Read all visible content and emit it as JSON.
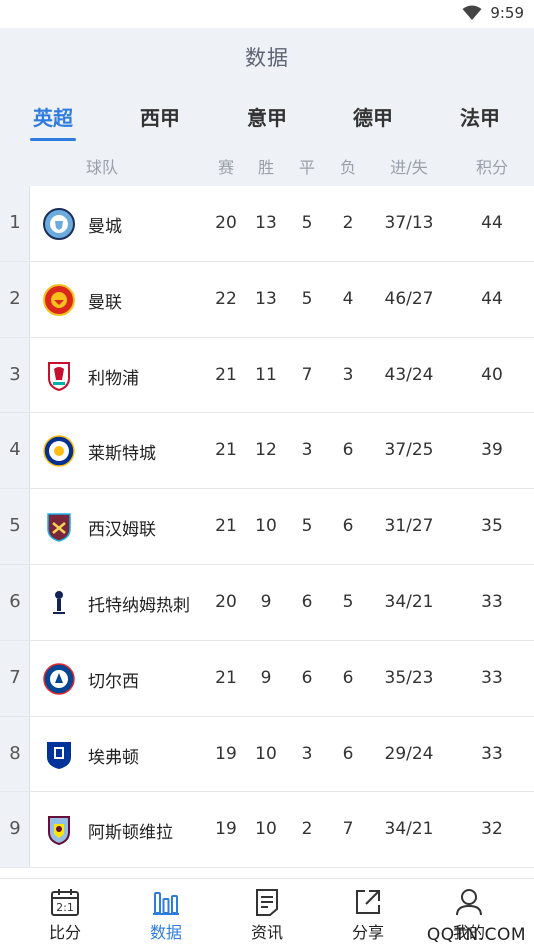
{
  "status_bar": {
    "time": "9:59"
  },
  "header": {
    "title": "数据"
  },
  "tabs": [
    {
      "label": "英超",
      "active": true
    },
    {
      "label": "西甲",
      "active": false
    },
    {
      "label": "意甲",
      "active": false
    },
    {
      "label": "德甲",
      "active": false
    },
    {
      "label": "法甲",
      "active": false
    }
  ],
  "columns": {
    "team": "球队",
    "played": "赛",
    "won": "胜",
    "drawn": "平",
    "lost": "负",
    "goals": "进/失",
    "points": "积分"
  },
  "rows": [
    {
      "rank": "1",
      "team": "曼城",
      "played": "20",
      "won": "13",
      "drawn": "5",
      "lost": "2",
      "goals": "37/13",
      "points": "44"
    },
    {
      "rank": "2",
      "team": "曼联",
      "played": "22",
      "won": "13",
      "drawn": "5",
      "lost": "4",
      "goals": "46/27",
      "points": "44"
    },
    {
      "rank": "3",
      "team": "利物浦",
      "played": "21",
      "won": "11",
      "drawn": "7",
      "lost": "3",
      "goals": "43/24",
      "points": "40"
    },
    {
      "rank": "4",
      "team": "莱斯特城",
      "played": "21",
      "won": "12",
      "drawn": "3",
      "lost": "6",
      "goals": "37/25",
      "points": "39"
    },
    {
      "rank": "5",
      "team": "西汉姆联",
      "played": "21",
      "won": "10",
      "drawn": "5",
      "lost": "6",
      "goals": "31/27",
      "points": "35"
    },
    {
      "rank": "6",
      "team": "托特纳姆热刺",
      "played": "20",
      "won": "9",
      "drawn": "6",
      "lost": "5",
      "goals": "34/21",
      "points": "33"
    },
    {
      "rank": "7",
      "team": "切尔西",
      "played": "21",
      "won": "9",
      "drawn": "6",
      "lost": "6",
      "goals": "35/23",
      "points": "33"
    },
    {
      "rank": "8",
      "team": "埃弗顿",
      "played": "19",
      "won": "10",
      "drawn": "3",
      "lost": "6",
      "goals": "29/24",
      "points": "33"
    },
    {
      "rank": "9",
      "team": "阿斯顿维拉",
      "played": "19",
      "won": "10",
      "drawn": "2",
      "lost": "7",
      "goals": "34/21",
      "points": "32"
    }
  ],
  "bottom_nav": [
    {
      "label": "比分",
      "icon": "calendar-score-icon",
      "icon_text": "2:1"
    },
    {
      "label": "数据",
      "icon": "bar-chart-icon",
      "active": true
    },
    {
      "label": "资讯",
      "icon": "document-icon"
    },
    {
      "label": "分享",
      "icon": "share-icon"
    },
    {
      "label": "我的",
      "icon": "user-icon"
    }
  ],
  "watermark": "QQTN.COM",
  "colors": {
    "accent": "#2f7ce0",
    "header_bg": "#eef1f6"
  }
}
